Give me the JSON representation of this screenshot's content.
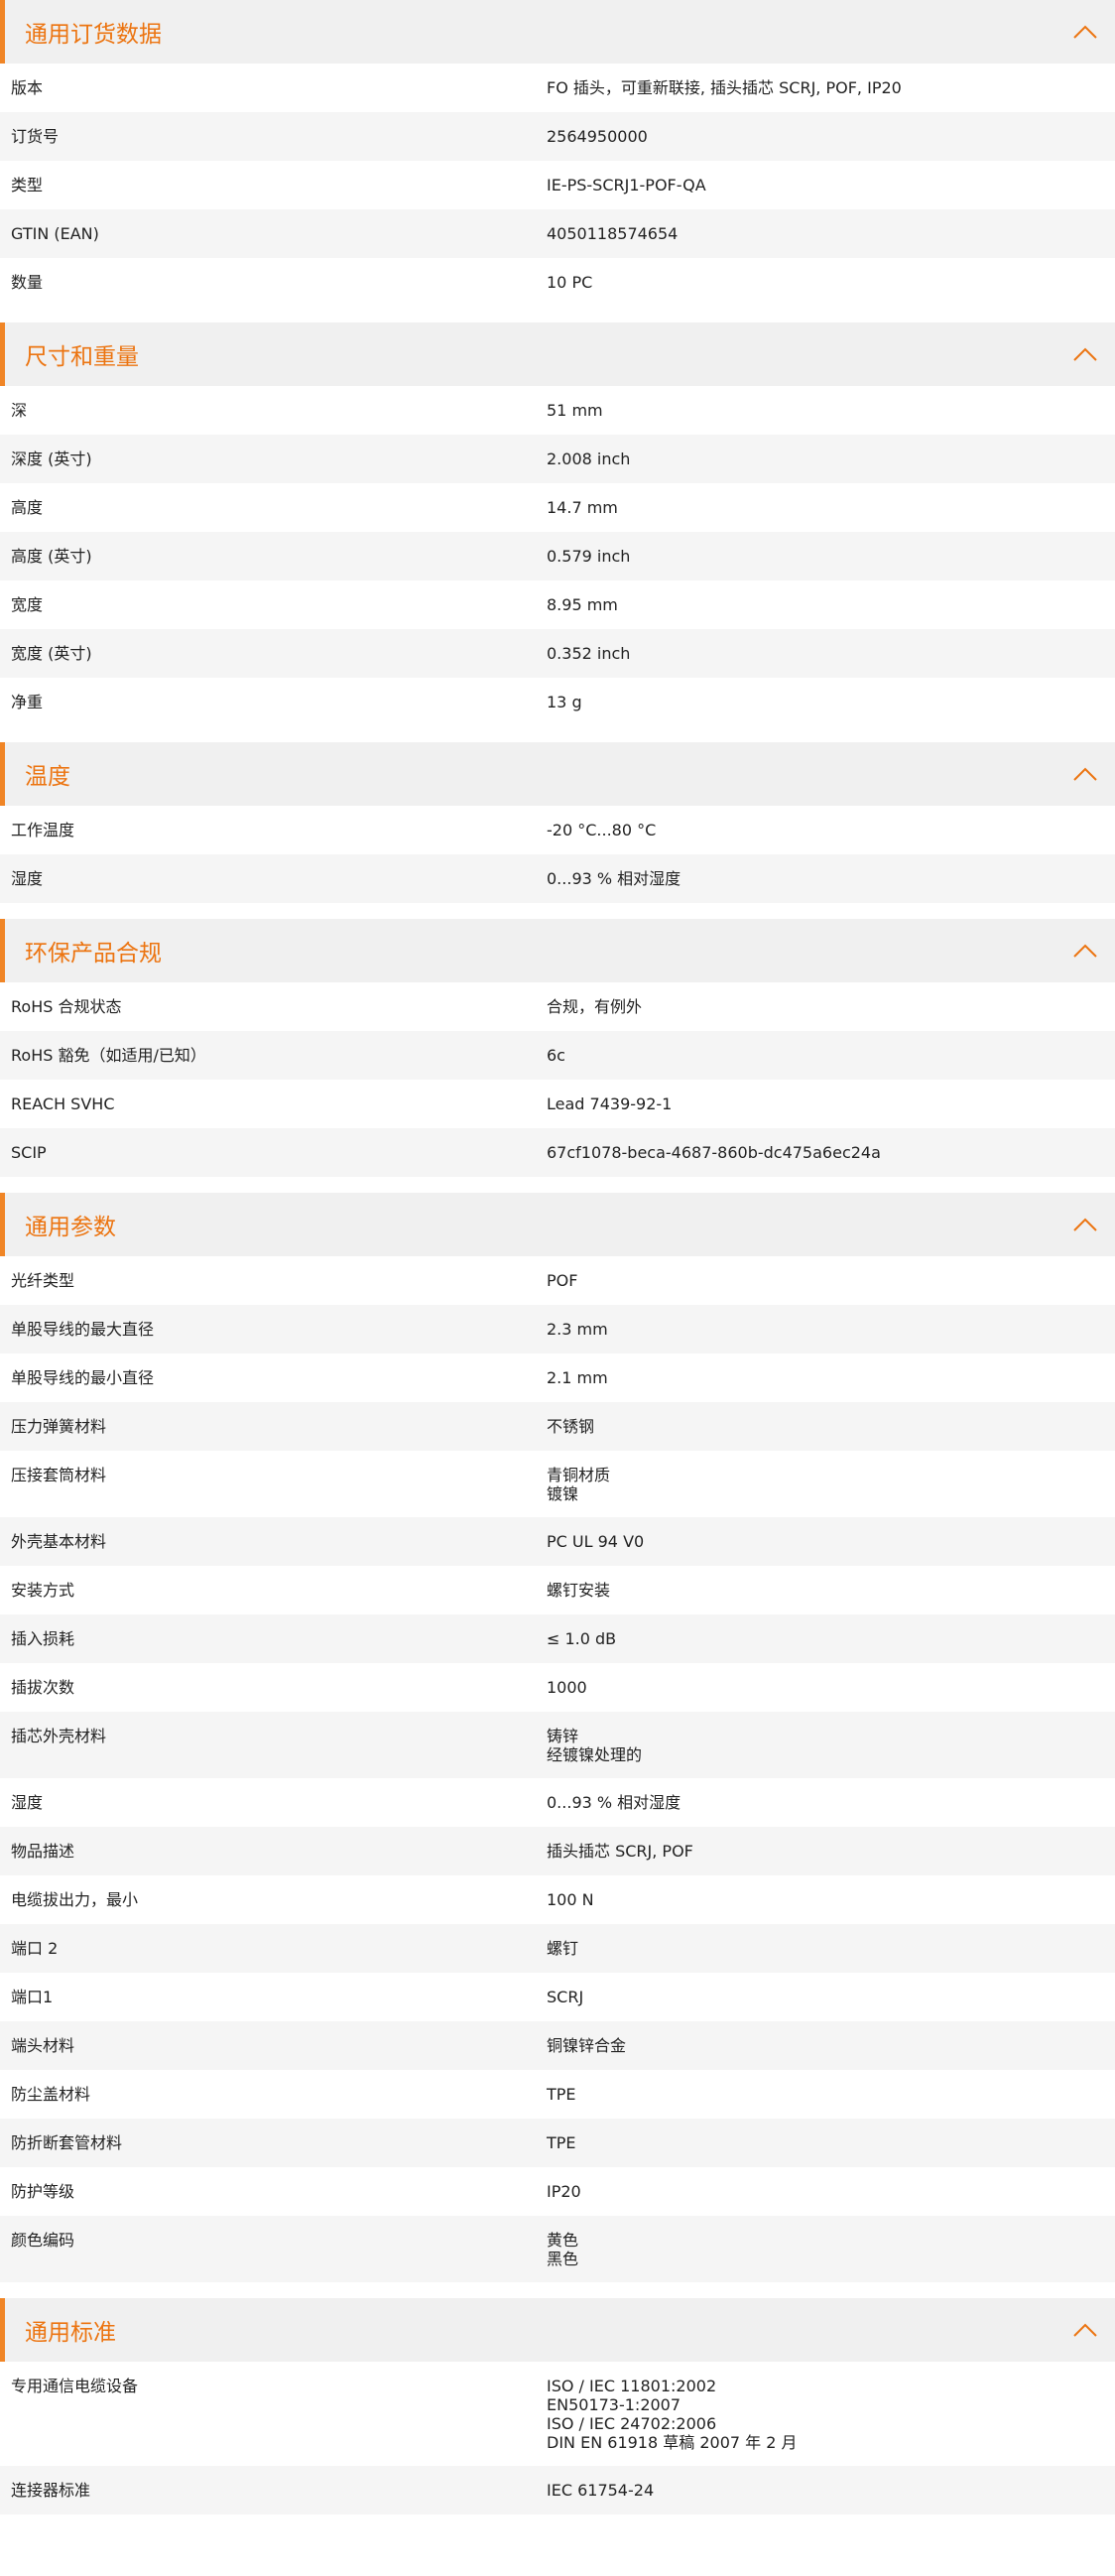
{
  "accent": "#ec7410",
  "sections": [
    {
      "title": "通用订货数据",
      "icon": "chevron-up-icon",
      "rows": [
        {
          "k": "版本",
          "v": "FO 插头，可重新联接, 插头插芯 SCRJ, POF, IP20"
        },
        {
          "k": "订货号",
          "v": "2564950000"
        },
        {
          "k": "类型",
          "v": "IE-PS-SCRJ1-POF-QA"
        },
        {
          "k": "GTIN (EAN)",
          "v": "4050118574654"
        },
        {
          "k": "数量",
          "v": "10  PC"
        }
      ]
    },
    {
      "title": "尺寸和重量",
      "icon": "chevron-up-icon",
      "rows": [
        {
          "k": "深",
          "v": "51  mm"
        },
        {
          "k": "深度 (英寸)",
          "v": "2.008  inch"
        },
        {
          "k": "高度",
          "v": "14.7  mm"
        },
        {
          "k": "高度 (英寸)",
          "v": "0.579  inch"
        },
        {
          "k": "宽度",
          "v": "8.95  mm"
        },
        {
          "k": "宽度 (英寸)",
          "v": "0.352  inch"
        },
        {
          "k": "净重",
          "v": "13  g"
        }
      ]
    },
    {
      "title": "温度",
      "icon": "chevron-up-icon",
      "rows": [
        {
          "k": "工作温度",
          "v": "-20 °C...80 °C"
        },
        {
          "k": "湿度",
          "v": "0...93 % 相对湿度"
        }
      ]
    },
    {
      "title": "环保产品合规",
      "icon": "chevron-up-icon",
      "rows": [
        {
          "k": "RoHS 合规状态",
          "v": "合规，有例外"
        },
        {
          "k": "RoHS 豁免（如适用/已知）",
          "v": "6c"
        },
        {
          "k": "REACH SVHC",
          "v": "Lead 7439-92-1"
        },
        {
          "k": "SCIP",
          "v": "67cf1078-beca-4687-860b-dc475a6ec24a"
        }
      ]
    },
    {
      "title": "通用参数",
      "icon": "chevron-up-icon",
      "rows": [
        {
          "k": "光纤类型",
          "v": "POF"
        },
        {
          "k": "单股导线的最大直径",
          "v": "2.3  mm"
        },
        {
          "k": "单股导线的最小直径",
          "v": "2.1  mm"
        },
        {
          "k": "压力弹簧材料",
          "v": "不锈钢"
        },
        {
          "k": "压接套筒材料",
          "v": "青铜材质\n镀镍"
        },
        {
          "k": "外壳基本材料",
          "v": "PC UL 94 V0"
        },
        {
          "k": "安装方式",
          "v": "螺钉安装"
        },
        {
          "k": "插入损耗",
          "v": "≤ 1.0 dB"
        },
        {
          "k": "插拔次数",
          "v": "1000"
        },
        {
          "k": "插芯外壳材料",
          "v": "铸锌\n经镀镍处理的"
        },
        {
          "k": "湿度",
          "v": "0...93 % 相对湿度"
        },
        {
          "k": "物品描述",
          "v": "插头插芯 SCRJ, POF"
        },
        {
          "k": "电缆拔出力，最小",
          "v": "100  N"
        },
        {
          "k": "端口 2",
          "v": "螺钉"
        },
        {
          "k": "端口1",
          "v": "SCRJ"
        },
        {
          "k": "端头材料",
          "v": "铜镍锌合金"
        },
        {
          "k": "防尘盖材料",
          "v": "TPE"
        },
        {
          "k": "防折断套管材料",
          "v": "TPE"
        },
        {
          "k": "防护等级",
          "v": "IP20"
        },
        {
          "k": "颜色编码",
          "v": "黄色\n黑色"
        }
      ]
    },
    {
      "title": "通用标准",
      "icon": "chevron-up-icon",
      "rows": [
        {
          "k": "专用通信电缆设备",
          "v": "ISO / IEC 11801:2002\nEN50173-1:2007\nISO / IEC 24702:2006\nDIN EN 61918 草稿 2007 年 2 月"
        },
        {
          "k": "连接器标准",
          "v": "IEC 61754-24"
        }
      ]
    }
  ]
}
